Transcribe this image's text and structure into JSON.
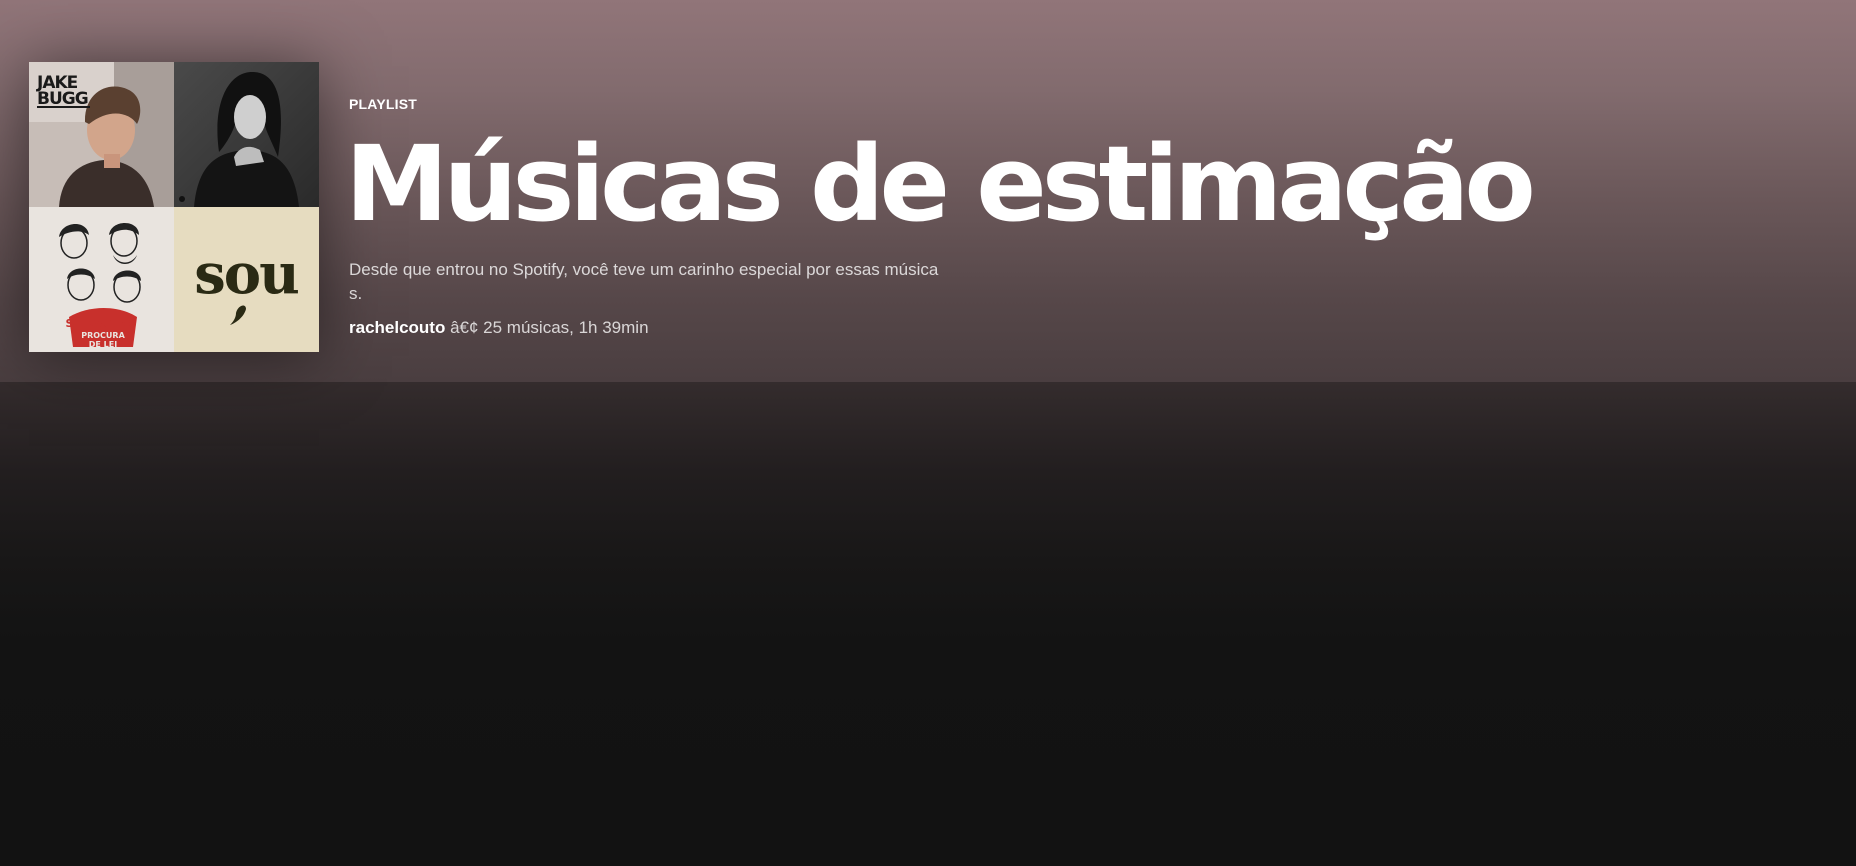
{
  "playlist": {
    "type_label": "PLAYLIST",
    "title": "Músicas de estimação",
    "description": "Desde que entrou no Spotify, você teve um carinho especial por essas músicas.",
    "owner": "rachelcouto",
    "separator": " â€¢ ",
    "stats": "25 músicas, 1h 39min"
  },
  "cover_tiles": [
    {
      "caption": "JAKE BUGG"
    },
    {
      "caption": ""
    },
    {
      "caption": "SELVAGENS PROCURA DE LEI"
    },
    {
      "caption": "sou"
    }
  ],
  "colors": {
    "header_top": "#917579",
    "header_bottom": "#4a3e40",
    "background": "#121212",
    "text_primary": "#ffffff",
    "text_secondary": "#d1c9ca"
  }
}
